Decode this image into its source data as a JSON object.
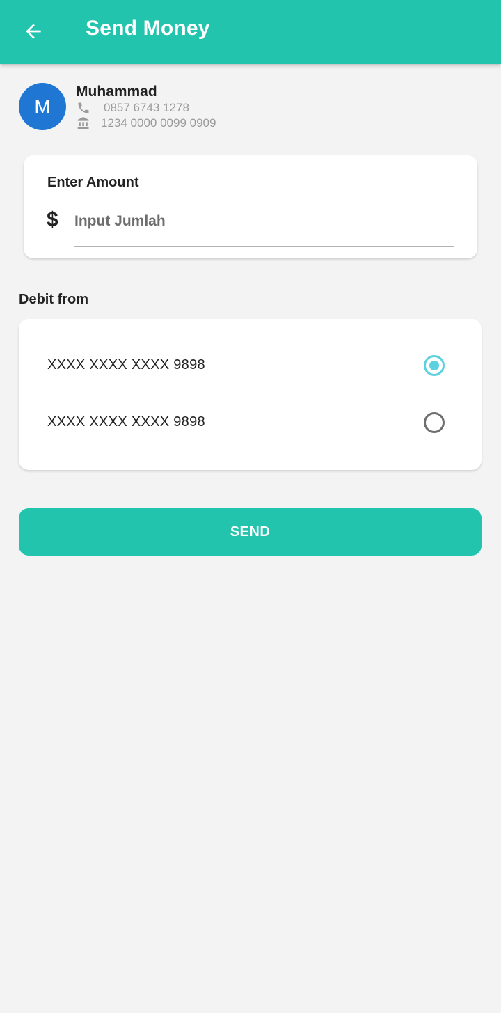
{
  "appbar": {
    "title": "Send Money",
    "back_icon": "arrow-left-icon",
    "color": "#22c4ad"
  },
  "contact": {
    "avatar_letter": "M",
    "avatar_color": "#1f76d3",
    "name": "Muhammad",
    "phone": "0857 6743 1278",
    "phone_icon": "phone-icon",
    "account": "1234 0000 0099 0909",
    "account_icon": "bank-icon"
  },
  "amount": {
    "title": "Enter Amount",
    "currency_symbol": "$",
    "placeholder": "Input Jumlah",
    "value": ""
  },
  "debit": {
    "label": "Debit from",
    "accounts": [
      {
        "number": "XXXX XXXX XXXX 9898",
        "selected": true
      },
      {
        "number": "XXXX XXXX XXXX 9898",
        "selected": false
      }
    ],
    "radio_accent": "#5ed1e0"
  },
  "actions": {
    "send_label": "SEND"
  }
}
